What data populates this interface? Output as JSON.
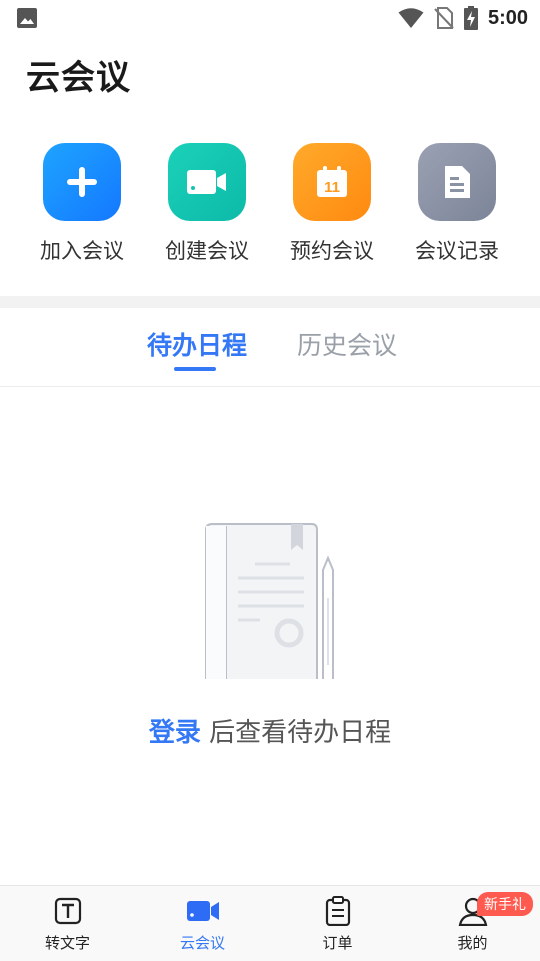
{
  "status_bar": {
    "time": "5:00"
  },
  "app_title": "云会议",
  "actions": [
    {
      "label": "加入会议",
      "icon": "plus-icon",
      "color": "#1a8cff"
    },
    {
      "label": "创建会议",
      "icon": "video-camera-icon",
      "color": "#12c4b0"
    },
    {
      "label": "预约会议",
      "icon": "calendar-icon",
      "color": "#ff9a1f",
      "calendar_day": "11"
    },
    {
      "label": "会议记录",
      "icon": "document-icon",
      "color": "#8a92a6"
    }
  ],
  "tabs": [
    {
      "label": "待办日程",
      "active": true
    },
    {
      "label": "历史会议",
      "active": false
    }
  ],
  "empty_state": {
    "login_link": "登录",
    "message": "后查看待办日程"
  },
  "bottom_nav": [
    {
      "label": "转文字",
      "icon": "text-t-icon",
      "active": false
    },
    {
      "label": "云会议",
      "icon": "video-camera-icon",
      "active": true
    },
    {
      "label": "订单",
      "icon": "clipboard-icon",
      "active": false
    },
    {
      "label": "我的",
      "icon": "user-icon",
      "active": false,
      "badge": "新手礼"
    }
  ],
  "colors": {
    "accent": "#3478f6",
    "badge": "#ff5a4f"
  }
}
